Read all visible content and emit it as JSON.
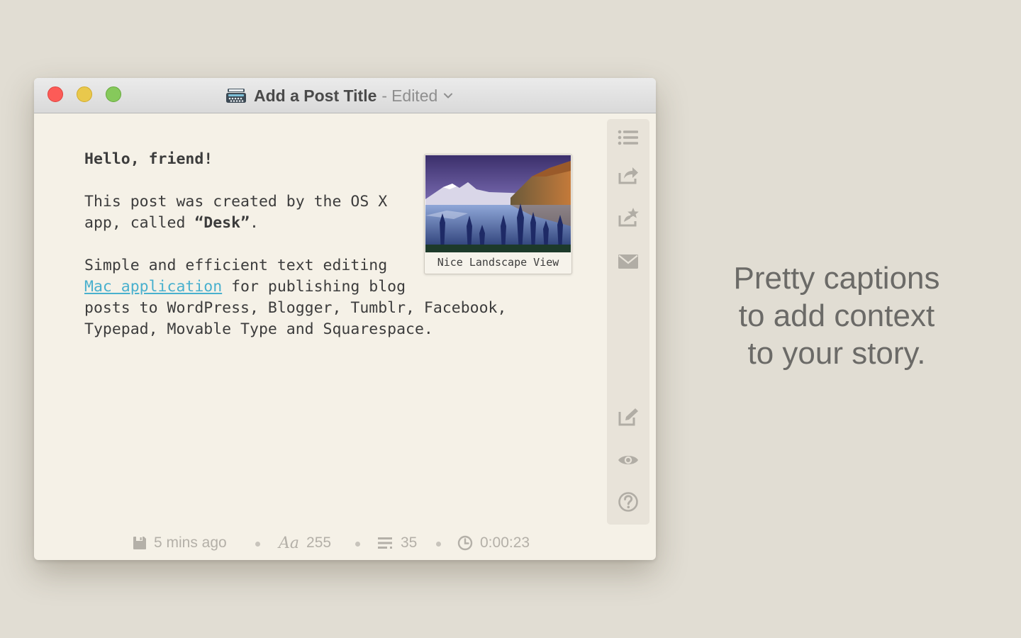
{
  "window": {
    "title": "Add a Post Title",
    "separator": "-",
    "status": "Edited"
  },
  "editor": {
    "greeting": "Hello, friend!",
    "para1_line1": "This post was created by the OS X",
    "para1_line2_before": "app, called ",
    "para1_line2_bold": "“Desk”",
    "para1_line2_after": ".",
    "para2_line1": "Simple and efficient text editing",
    "para2_link": "Mac application",
    "para2_line2_after": " for publishing blog",
    "para2_line3": "posts to WordPress, Blogger, Tumblr, Facebook,",
    "para2_line4": "Typepad, Movable Type and Squarespace."
  },
  "figure": {
    "caption": "Nice Landscape View"
  },
  "sidebar": {
    "icons": [
      "list-icon",
      "share-icon",
      "favorite-share-icon",
      "mail-icon",
      "edit-icon",
      "preview-eye-icon",
      "help-icon"
    ]
  },
  "status": {
    "saved": "5 mins ago",
    "font_glyph": "Aa",
    "word_count": "255",
    "line_count": "35",
    "timer": "0:00:23"
  },
  "promo": {
    "line1": "Pretty captions",
    "line2": "to add context",
    "line3": "to your story."
  },
  "colors": {
    "background": "#e1ddd3",
    "window": "#f5f1e7",
    "link": "#49b0ce",
    "close": "#fc5b57",
    "minimize": "#e9c84c",
    "zoom": "#86c95b"
  }
}
